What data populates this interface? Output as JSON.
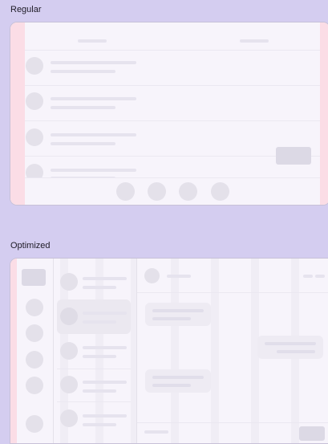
{
  "labels": {
    "regular": "Regular",
    "optimized": "Optimized"
  },
  "colors": {
    "background": "#d4cdf0",
    "surface": "#f7f4fb",
    "margin_highlight": "#fbdde6",
    "placeholder": "#e6e3ee"
  }
}
